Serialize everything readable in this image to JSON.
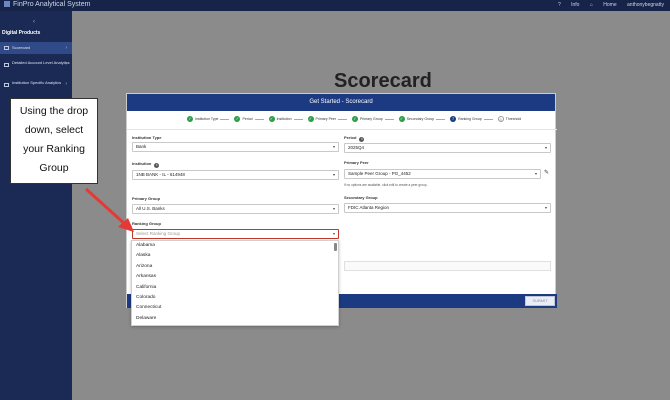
{
  "topbar": {
    "app_title": "FinPro Analytical System",
    "info_label": "Info",
    "home_label": "Home",
    "user": "anthonybegnatty"
  },
  "sidebar": {
    "section_title": "Digital Products",
    "items": [
      {
        "label": "Scorecard",
        "active": true
      },
      {
        "label": "Detailed Account Level Analytics"
      },
      {
        "label": "Institution Specific Analytics"
      }
    ]
  },
  "page": {
    "title": "Scorecard"
  },
  "modal": {
    "title": "Get Started - Scorecard",
    "steps": [
      {
        "label": "Institution Type",
        "state": "done"
      },
      {
        "label": "Period",
        "state": "done"
      },
      {
        "label": "Institution",
        "state": "done"
      },
      {
        "label": "Primary Peer",
        "state": "done"
      },
      {
        "label": "Primary Group",
        "state": "done"
      },
      {
        "label": "Secondary Group",
        "state": "done"
      },
      {
        "label": "Ranking Group",
        "state": "current",
        "number": "7"
      },
      {
        "label": "Threshold",
        "state": "pending",
        "number": "8"
      }
    ],
    "fields": {
      "institution_type": {
        "label": "Institution Type",
        "value": "Bank"
      },
      "period": {
        "label": "Period",
        "value": "2025Q4"
      },
      "institution": {
        "label": "Institution",
        "value": "1NB BANK - IL - 614948"
      },
      "primary_peer": {
        "label": "Primary Peer",
        "value": "Sample Peer Group - PG_4452",
        "helper": "If no options are available, click edit to create a peer group."
      },
      "primary_group": {
        "label": "Primary Group",
        "value": "All U.S. Banks"
      },
      "secondary_group": {
        "label": "Secondary Group",
        "value": "FDIC Atlanta Region"
      },
      "ranking_group": {
        "label": "Ranking Group",
        "placeholder": "Select Ranking Group"
      }
    },
    "submit_label": "SUBMIT"
  },
  "dropdown": {
    "options": [
      "Alabama",
      "Alaska",
      "Arizona",
      "Arkansas",
      "California",
      "Colorado",
      "Connecticut",
      "Delaware"
    ]
  },
  "annotation": {
    "text_lines": [
      "Using the drop",
      "down, select",
      "your Ranking",
      "Group"
    ],
    "arrow_color": "#e53935"
  },
  "colors": {
    "navy": "#1b3a82",
    "sidebar": "#1b2a55",
    "done_green": "#2c9c4a",
    "focus_red": "#c0392b"
  }
}
